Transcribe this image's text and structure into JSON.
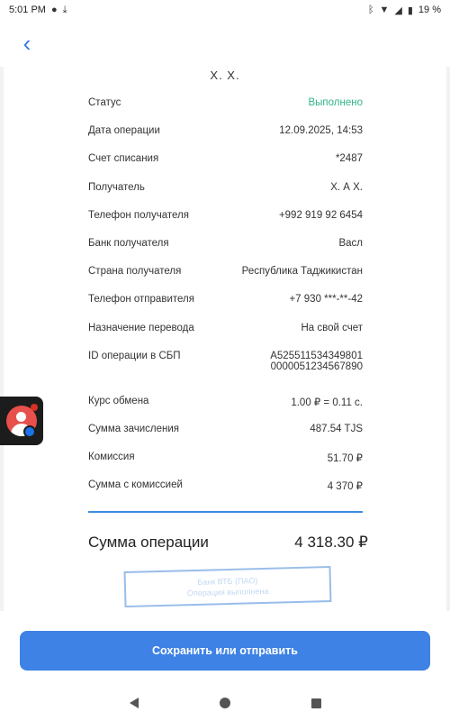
{
  "status_bar": {
    "time": "5:01 PM",
    "battery": "19 %",
    "left_icons": [
      "chat-bubble-icon",
      "download-icon"
    ],
    "right_icons": [
      "bluetooth-icon",
      "wifi-icon",
      "signal-icon",
      "battery-icon"
    ]
  },
  "topbar": {
    "back_icon": "chevron-left-icon",
    "back_glyph": "‹"
  },
  "receipt": {
    "sender_name": "Х. Х.",
    "rows": [
      {
        "label": "Статус",
        "value": "Выполнено"
      },
      {
        "label": "Дата операции",
        "value": "12.09.2025, 14:53"
      },
      {
        "label": "Счет списания",
        "value": "*2487"
      },
      {
        "label": "Получатель",
        "value": "Х. А Х."
      },
      {
        "label": "Телефон получателя",
        "value": "+992 919 92 6454"
      },
      {
        "label": "Банк получателя",
        "value": "Васл"
      },
      {
        "label": "Страна получателя",
        "value": "Республика Таджикистан"
      },
      {
        "label": "Телефон отправителя",
        "value": "+7 930 ***-**-42"
      },
      {
        "label": "Назначение перевода",
        "value": "На свой счет"
      },
      {
        "label": "ID операции в СБП",
        "value": "A525511534349801",
        "value_line2": "0000051234567890"
      },
      {
        "label": "Курс обмена",
        "value": "1.00 ₽ = 0.11 с."
      },
      {
        "label": "Сумма зачисления",
        "value": "487.54 TJS"
      },
      {
        "label": "Комиссия",
        "value": "51.70 ₽"
      },
      {
        "label": "Сумма с комиссией",
        "value": "4 370 ₽"
      }
    ],
    "total_label": "Сумма операции",
    "total_value": "4 318.30 ₽",
    "stamp_line1": "Банк ВТБ (ПАО)",
    "stamp_line2": "Операция выполнена"
  },
  "floating_app": {
    "icon": "contacts-app-icon"
  },
  "actions": {
    "primary_label": "Сохранить или отправить"
  },
  "colors": {
    "accent": "#3d82e4",
    "success": "#2fb487",
    "separator": "#3d8be0"
  }
}
